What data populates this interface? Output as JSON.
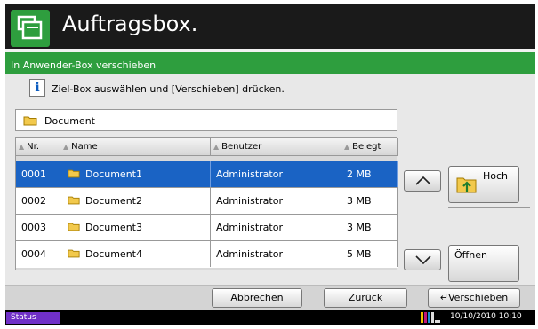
{
  "header": {
    "title": "Auftragsbox.",
    "icon": "job-box-icon"
  },
  "panel": {
    "title": "In Anwender-Box verschieben",
    "info_text": "Ziel-Box auswählen und [Verschieben] drücken.",
    "info_icon": "info-icon"
  },
  "path": {
    "label": "Document",
    "icon": "folder-icon"
  },
  "table": {
    "columns": [
      "Nr.",
      "Name",
      "Benutzer",
      "Belegt"
    ],
    "rows": [
      {
        "nr": "0001",
        "name": "Document1",
        "user": "Administrator",
        "used": "2  MB"
      },
      {
        "nr": "0002",
        "name": "Document2",
        "user": "Administrator",
        "used": "3  MB"
      },
      {
        "nr": "0003",
        "name": "Document3",
        "user": "Administrator",
        "used": "3  MB"
      },
      {
        "nr": "0004",
        "name": "Document4",
        "user": "Administrator",
        "used": "5  MB"
      }
    ]
  },
  "side_buttons": {
    "up": "Hoch",
    "open": "Öffnen"
  },
  "bottom": {
    "cancel": "Abbrechen",
    "back": "Zurück",
    "move": "Verschieben"
  },
  "status": {
    "label": "Status",
    "datetime": "10/10/2010  10:10"
  },
  "colors": {
    "accent_green": "#2e9e3e",
    "selection_blue": "#1a63c4",
    "status_purple": "#7030c8"
  }
}
